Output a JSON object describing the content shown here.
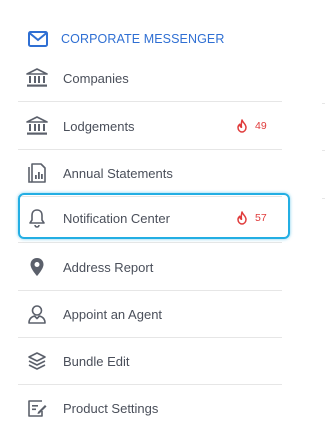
{
  "header": {
    "title": "CORPORATE MESSENGER",
    "icon": "envelope-icon",
    "color": "#2f6fd3"
  },
  "items": [
    {
      "label": "Companies",
      "icon": "bank-icon",
      "badge": null
    },
    {
      "label": "Lodgements",
      "icon": "bank-icon",
      "badge": "49"
    },
    {
      "label": "Annual Statements",
      "icon": "document-chart-icon",
      "badge": null
    },
    {
      "label": "Notification Center",
      "icon": "bell-icon",
      "badge": "57"
    },
    {
      "label": "Address Report",
      "icon": "map-pin-icon",
      "badge": null
    },
    {
      "label": "Appoint an Agent",
      "icon": "user-icon",
      "badge": null
    },
    {
      "label": "Bundle Edit",
      "icon": "layers-icon",
      "badge": null
    },
    {
      "label": "Product Settings",
      "icon": "edit-list-icon",
      "badge": null
    }
  ],
  "colors": {
    "badge": "#e03b3b",
    "highlight": "#23aee3",
    "text": "#4a4f5a",
    "icon": "#5b606b"
  }
}
